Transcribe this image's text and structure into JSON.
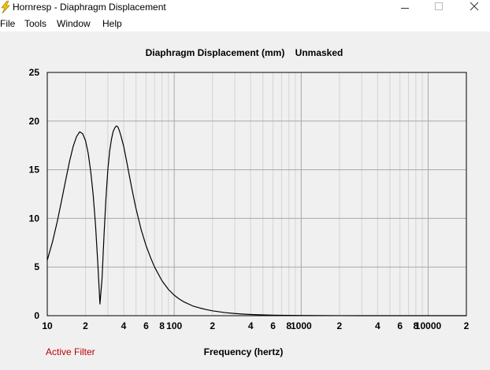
{
  "window": {
    "title": "Hornresp - Diaphragm Displacement",
    "app_icon": "lightning-bolt-icon"
  },
  "menu": {
    "items": [
      "File",
      "Tools",
      "Window",
      "Help"
    ]
  },
  "status": {
    "filter_label": "Active Filter",
    "filter_color": "#c00000"
  },
  "chart_data": {
    "type": "line",
    "title": "Diaphragm Displacement (mm)    Unmasked",
    "xlabel": "Frequency (hertz)",
    "ylabel": "",
    "xscale": "log",
    "xlim": [
      10,
      20000
    ],
    "ylim": [
      0,
      25
    ],
    "yticks": [
      "25",
      "20",
      "15",
      "10",
      "5",
      "0"
    ],
    "xtick_labels": [
      {
        "v": 10,
        "t": "10"
      },
      {
        "v": 20,
        "t": "2"
      },
      {
        "v": 40,
        "t": "4"
      },
      {
        "v": 60,
        "t": "6"
      },
      {
        "v": 80,
        "t": "8"
      },
      {
        "v": 100,
        "t": "100"
      },
      {
        "v": 200,
        "t": "2"
      },
      {
        "v": 400,
        "t": "4"
      },
      {
        "v": 600,
        "t": "6"
      },
      {
        "v": 800,
        "t": "8"
      },
      {
        "v": 1000,
        "t": "1000"
      },
      {
        "v": 2000,
        "t": "2"
      },
      {
        "v": 4000,
        "t": "4"
      },
      {
        "v": 6000,
        "t": "6"
      },
      {
        "v": 8000,
        "t": "8"
      },
      {
        "v": 10000,
        "t": "10000"
      },
      {
        "v": 20000,
        "t": "2"
      }
    ],
    "grid": true,
    "series": [
      {
        "color": "#000000",
        "x": [
          10,
          11,
          12,
          13,
          14,
          15,
          16,
          17,
          18,
          19,
          20,
          21,
          22,
          23,
          24,
          25,
          26,
          27,
          28,
          29,
          30,
          31,
          32,
          33,
          34,
          35,
          36,
          37,
          38,
          40,
          42,
          44,
          46,
          48,
          50,
          55,
          60,
          65,
          70,
          80,
          90,
          100,
          110,
          120,
          140,
          160,
          180,
          200,
          250,
          300,
          350,
          400,
          500,
          600,
          800,
          1000,
          1500,
          2000,
          3000,
          5000,
          10000,
          20000
        ],
        "y": [
          5.7,
          7.6,
          9.7,
          11.9,
          14.0,
          15.9,
          17.4,
          18.4,
          18.9,
          18.7,
          18.0,
          16.7,
          14.8,
          12.4,
          9.3,
          5.4,
          1.2,
          3.8,
          8.3,
          12.1,
          15.0,
          16.9,
          18.1,
          18.9,
          19.3,
          19.5,
          19.4,
          19.0,
          18.5,
          17.4,
          16.0,
          14.6,
          13.3,
          12.1,
          11.0,
          8.8,
          7.2,
          6.0,
          5.0,
          3.6,
          2.7,
          2.1,
          1.7,
          1.4,
          1.0,
          0.78,
          0.62,
          0.5,
          0.32,
          0.22,
          0.16,
          0.12,
          0.08,
          0.055,
          0.03,
          0.02,
          0.009,
          0.005,
          0.002,
          0.001,
          0.0003,
          0.0001
        ]
      }
    ]
  }
}
